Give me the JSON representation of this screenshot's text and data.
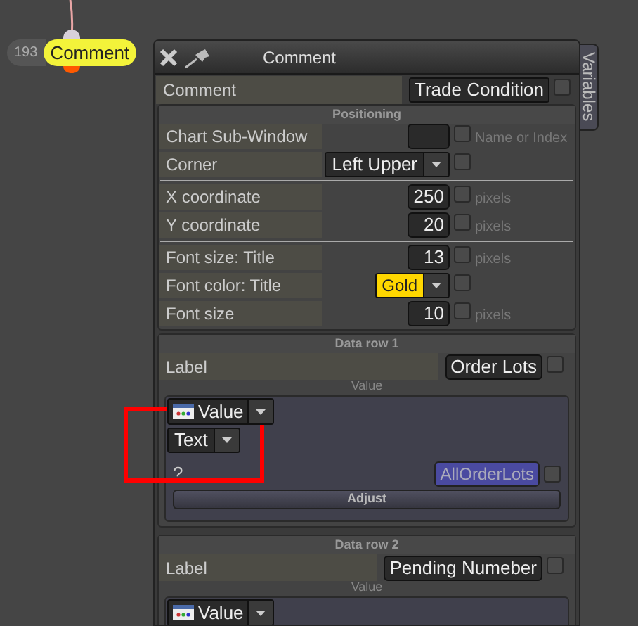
{
  "node": {
    "number": "193",
    "label": "Comment"
  },
  "panel": {
    "title": "Comment",
    "side_tab": "Variables",
    "comment": {
      "label": "Comment",
      "value": "Trade Condition",
      "checked": false
    },
    "positioning": {
      "title": "Positioning",
      "groups": [
        [
          {
            "kind": "input",
            "label": "Chart Sub-Window",
            "checked": false,
            "hint": "Name or Index"
          },
          {
            "kind": "dropdown",
            "label": "Corner",
            "value": "Left Upper",
            "checked": false
          }
        ],
        [
          {
            "kind": "input",
            "label": "X coordinate",
            "value": "250",
            "checked": false,
            "hint": "pixels"
          },
          {
            "kind": "input",
            "label": "Y coordinate",
            "value": "20",
            "checked": false,
            "hint": "pixels"
          }
        ],
        [
          {
            "kind": "input",
            "label": "Font size: Title",
            "value": "13",
            "checked": false,
            "hint": "pixels"
          },
          {
            "kind": "color",
            "label": "Font color: Title",
            "value": "Gold",
            "color": "#ffd700",
            "checked": false
          },
          {
            "kind": "input",
            "label": "Font size",
            "value": "10",
            "checked": false,
            "hint": "pixels"
          }
        ]
      ]
    },
    "data_rows": [
      {
        "title": "Data row 1",
        "label": "Label",
        "value": "Order Lots",
        "checked": false,
        "value_caption": "Value",
        "source": "Value",
        "type": "Text",
        "param": "?",
        "variable": "AllOrderLots",
        "variable_checked": false,
        "button": "Adjust"
      },
      {
        "title": "Data row 2",
        "label": "Label",
        "value": "Pending Numeber",
        "checked": false,
        "value_caption": "Value",
        "source": "Value"
      }
    ]
  }
}
